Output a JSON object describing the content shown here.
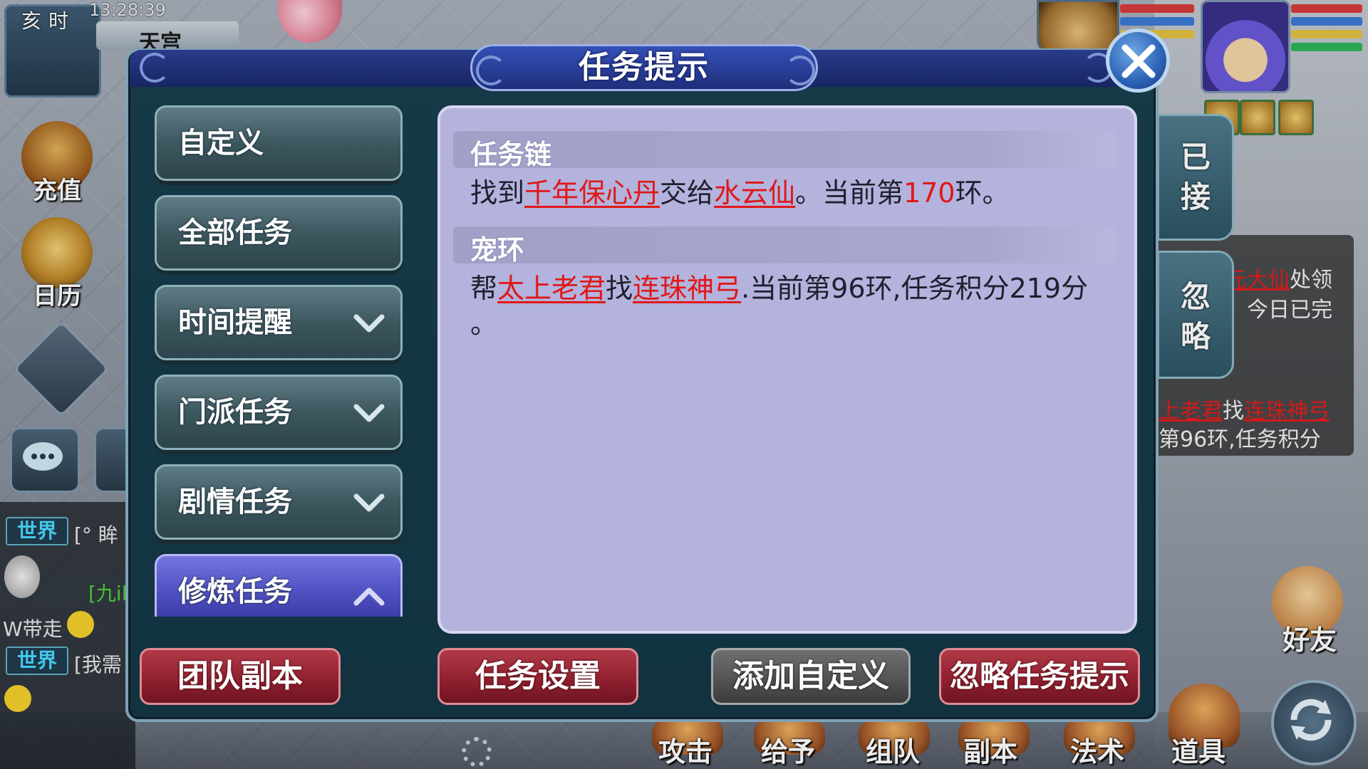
{
  "scene": {
    "clock": {
      "shichen": "亥时",
      "time": "13:28:39"
    },
    "map_name": "天宫",
    "left_icons": [
      {
        "label": "充值",
        "icon": "treasure-chest-icon"
      },
      {
        "label": "日历",
        "icon": "calendar-icon"
      }
    ],
    "chat": {
      "lines": [
        {
          "channel": "世界",
          "text": "[°  眸"
        },
        {
          "channel": "",
          "text": "[九il"
        },
        {
          "channel": "",
          "text": "W带走"
        },
        {
          "channel": "世界",
          "text": "[我需"
        }
      ]
    },
    "tracker": {
      "line1_a": "元大仙",
      "line1_b": "处领",
      "line2": "，今日已完",
      "line3_a": "上老君",
      "line3_b": "找",
      "line3_c": "连珠神弓",
      "line4": "第96环,任务积分"
    },
    "side_tabs": [
      {
        "label_top": "已",
        "label_bottom": "接"
      },
      {
        "label_top": "忽",
        "label_bottom": "略"
      }
    ],
    "friend_label": "好友",
    "bottom_actions": [
      "攻击",
      "给予",
      "组队",
      "副本",
      "法术",
      "道具"
    ]
  },
  "dialog": {
    "title": "任务提示",
    "categories": [
      {
        "label": "自定义",
        "chevron": ""
      },
      {
        "label": "全部任务",
        "chevron": ""
      },
      {
        "label": "时间提醒",
        "chevron": "down"
      },
      {
        "label": "门派任务",
        "chevron": "down"
      },
      {
        "label": "剧情任务",
        "chevron": "down"
      },
      {
        "label": "修炼任务",
        "chevron": "up",
        "active": true
      }
    ],
    "sections": [
      {
        "title": "任务链",
        "parts": {
          "p1": "找到",
          "link1": "千年保心丹",
          "p2": "交给",
          "link2": "水云仙",
          "p3": "。当前第",
          "num": "170",
          "p4": "环。"
        }
      },
      {
        "title": "宠环",
        "parts": {
          "p1": "帮",
          "link1": "太上老君",
          "p2": "找",
          "link2": "连珠神弓",
          "p3": ".当前第96环,任务积分219分",
          "p4": "。"
        }
      }
    ],
    "buttons": {
      "team_dungeon": "团队副本",
      "task_settings": "任务设置",
      "add_custom": "添加自定义",
      "ignore_hint": "忽略任务提示"
    }
  },
  "colors": {
    "link_red": "#e01818",
    "content_bg": "#b3b3dd",
    "header_blue": "#1f2f7c",
    "active_category": "#5253c4",
    "red_button": "#8e1f2e",
    "gray_button": "#4f5153",
    "chat_channel": "#49d9ff"
  }
}
